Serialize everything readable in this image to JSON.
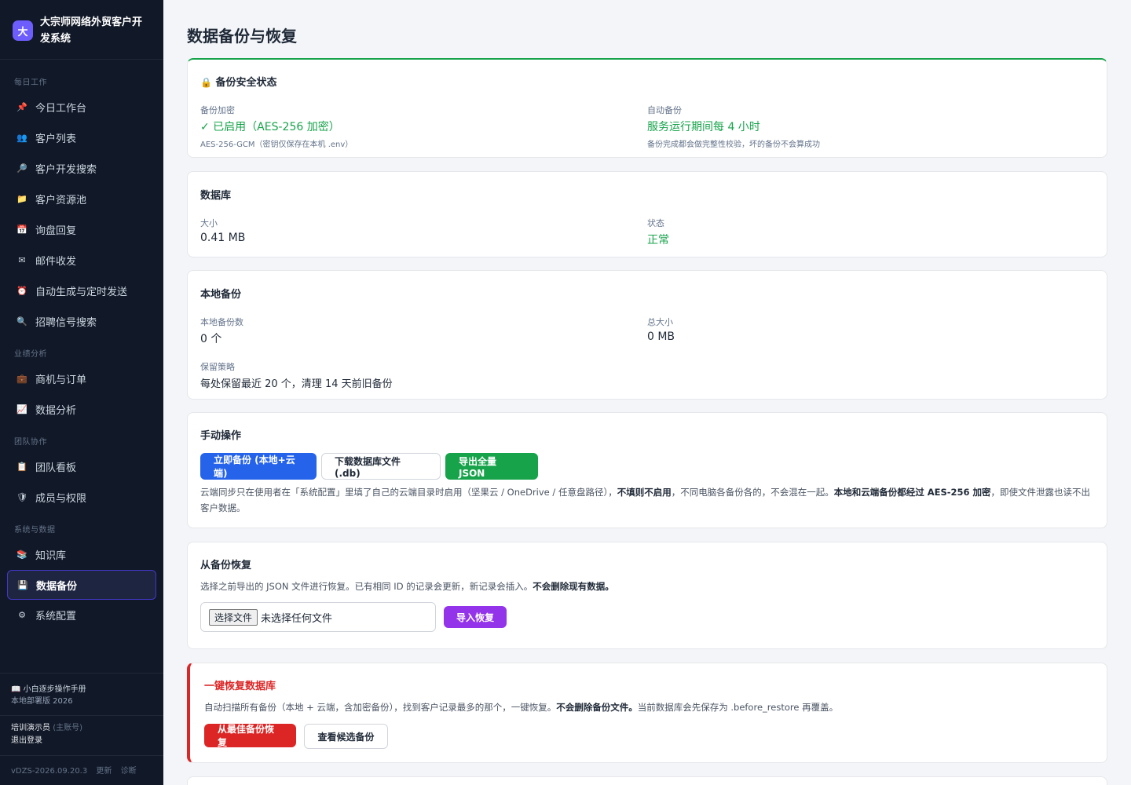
{
  "brand": {
    "logo": "大",
    "name": "大宗师网络外贸客户开发系统"
  },
  "nav": {
    "groups": [
      {
        "title": "每日工作",
        "items": [
          {
            "icon": "📌",
            "label": "今日工作台"
          },
          {
            "icon": "👥",
            "label": "客户列表"
          },
          {
            "icon": "🔎",
            "label": "客户开发搜索"
          },
          {
            "icon": "📁",
            "label": "客户资源池"
          },
          {
            "icon": "📅",
            "label": "询盘回复"
          },
          {
            "icon": "✉",
            "label": "邮件收发"
          },
          {
            "icon": "⏰",
            "label": "自动生成与定时发送"
          },
          {
            "icon": "🔍",
            "label": "招聘信号搜索"
          }
        ]
      },
      {
        "title": "业绩分析",
        "items": [
          {
            "icon": "💼",
            "label": "商机与订单"
          },
          {
            "icon": "📈",
            "label": "数据分析"
          }
        ]
      },
      {
        "title": "团队协作",
        "items": [
          {
            "icon": "📋",
            "label": "团队看板"
          },
          {
            "icon": "🛡",
            "label": "成员与权限"
          }
        ]
      },
      {
        "title": "系统与数据",
        "items": [
          {
            "icon": "📚",
            "label": "知识库"
          },
          {
            "icon": "💾",
            "label": "数据备份",
            "active": true
          },
          {
            "icon": "⚙",
            "label": "系统配置"
          }
        ]
      }
    ]
  },
  "footer": {
    "manual_icon": "📖",
    "manual": "小白逐步操作手册",
    "edition": "本地部署版 2026",
    "user": "培训演示员",
    "role": "(主账号)",
    "logout": "退出登录",
    "version": "vDZS-2026.09.20.3",
    "update": "更新",
    "diagnose": "诊断"
  },
  "page": {
    "title": "数据备份与恢复"
  },
  "security": {
    "icon": "🔒",
    "title": "备份安全状态",
    "enc_label": "备份加密",
    "enc_value": "✓ 已启用（AES-256 加密）",
    "enc_note": "AES-256-GCM（密钥仅保存在本机 .env）",
    "auto_label": "自动备份",
    "auto_value": "服务运行期间每 4 小时",
    "auto_note": "备份完成都会做完整性校验，坏的备份不会算成功"
  },
  "database": {
    "title": "数据库",
    "size_label": "大小",
    "size_value": "0.41 MB",
    "status_label": "状态",
    "status_value": "正常"
  },
  "local": {
    "title": "本地备份",
    "count_label": "本地备份数",
    "count_value": "0 个",
    "total_label": "总大小",
    "total_value": "0 MB",
    "policy_label": "保留策略",
    "policy_value": "每处保留最近 20 个，清理 14 天前旧备份"
  },
  "manual": {
    "title": "手动操作",
    "btn_backup": "立即备份 (本地+云端)",
    "btn_download": "下载数据库文件 (.db)",
    "btn_export": "导出全量 JSON",
    "note_1": "云端同步只在使用者在「系统配置」里填了自己的云端目录时启用（坚果云 / OneDrive / 任意盘路径），",
    "note_2": "不填则不启用",
    "note_3": "，不同电脑各备份各的，不会混在一起。",
    "note_4": "本地和云端备份都经过 AES-256 加密",
    "note_5": "，即使文件泄露也读不出客户数据。"
  },
  "restore": {
    "title": "从备份恢复",
    "note_1": "选择之前导出的 JSON 文件进行恢复。已有相同 ID 的记录会更新，新记录会插入。",
    "note_2": "不会删除现有数据。",
    "choose_btn": "选择文件",
    "no_file": "未选择任何文件",
    "import_btn": "导入恢复"
  },
  "oneclick": {
    "title": "一键恢复数据库",
    "note_1": "自动扫描所有备份（本地 + 云端，含加密备份），找到客户记录最多的那个，一键恢复。",
    "note_2": "不会删除备份文件。",
    "note_3": "当前数据库会先保存为 .before_restore 再覆盖。",
    "btn_restore": "从最佳备份恢复",
    "btn_view": "查看候选备份"
  },
  "colors": {
    "accent": "#6d5dfc",
    "sidebar": "#111827",
    "green": "#16a34a",
    "blue": "#2563eb",
    "purple": "#9333ea",
    "red": "#dc2626"
  }
}
